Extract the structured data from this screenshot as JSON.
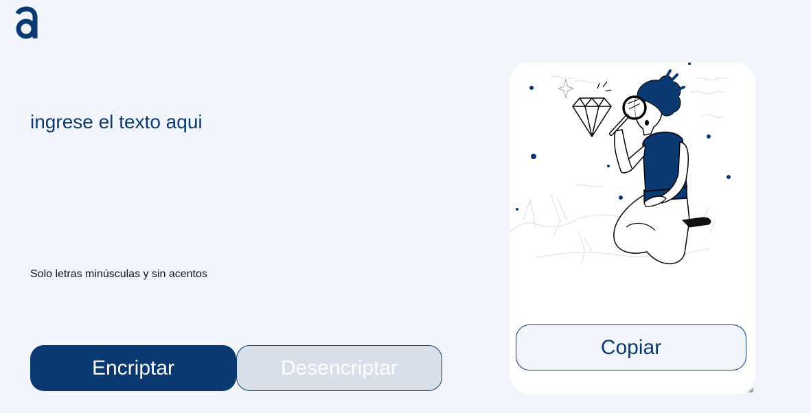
{
  "logo": {
    "icon": "alura-a-logo-icon",
    "color": "#0a3871"
  },
  "input": {
    "placeholder": "ingrese el texto aqui",
    "value": ""
  },
  "hint": {
    "text": "Solo letras minúsculas y sin acentos"
  },
  "buttons": {
    "encrypt_label": "Encriptar",
    "decrypt_label": "Desencriptar"
  },
  "output": {
    "illustration": "person-with-magnifying-glass-illustration",
    "copy_label": "Copiar"
  },
  "colors": {
    "background": "#f3f5fc",
    "primary": "#0a3871",
    "secondary": "#d8dfe8",
    "panel": "#ffffff"
  }
}
